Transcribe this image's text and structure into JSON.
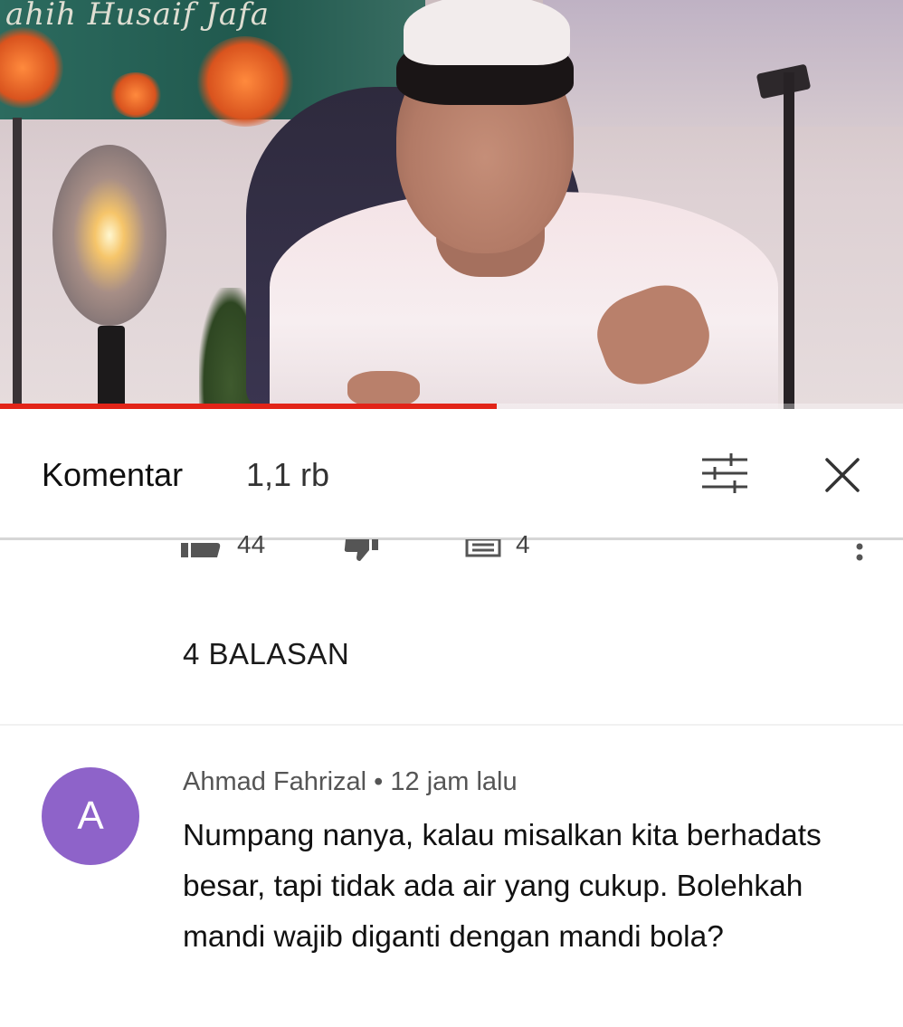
{
  "video": {
    "banner_text": "ahih Husaif Jafa",
    "progress_fraction": 0.55,
    "progress_color": "#e22418"
  },
  "comments_header": {
    "title": "Komentar",
    "count": "1,1 rb",
    "sort_icon": "sort-filter-icon",
    "close_icon": "close-icon"
  },
  "parent_comment_actions": {
    "like_count": "44",
    "reply_count": "4"
  },
  "replies_link": "4 BALASAN",
  "reply": {
    "avatar_letter": "A",
    "avatar_color": "#8e63c9",
    "author": "Ahmad Fahrizal",
    "separator": "•",
    "time": "12 jam lalu",
    "text": "Numpang nanya, kalau misalkan kita berhadats besar, tapi tidak ada air yang cukup. Bolehkah mandi wajib diganti dengan mandi bola?"
  }
}
